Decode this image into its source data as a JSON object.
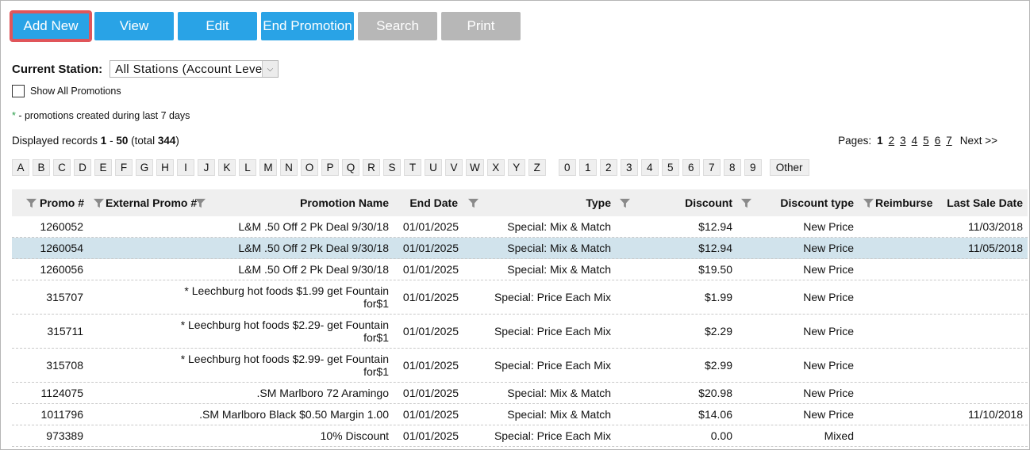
{
  "toolbar": {
    "add_new": "Add New",
    "view": "View",
    "edit": "Edit",
    "end_promotion": "End Promotion",
    "search": "Search",
    "print": "Print"
  },
  "station": {
    "label": "Current Station:",
    "selected": "All Stations (Account Level)"
  },
  "show_all_label": "Show All Promotions",
  "note": {
    "star": "*",
    "text": " - promotions created during last 7 days"
  },
  "records": {
    "prefix": "Displayed records ",
    "from": "1",
    "dash": " - ",
    "to": "50",
    "total_prefix": " (total ",
    "total": "344",
    "total_suffix": ")"
  },
  "pages": {
    "label": "Pages:",
    "current": "1",
    "list": [
      "2",
      "3",
      "4",
      "5",
      "6",
      "7"
    ],
    "next": "Next >>"
  },
  "alpha_letters": [
    "A",
    "B",
    "C",
    "D",
    "E",
    "F",
    "G",
    "H",
    "I",
    "J",
    "K",
    "L",
    "M",
    "N",
    "O",
    "P",
    "Q",
    "R",
    "S",
    "T",
    "U",
    "V",
    "W",
    "X",
    "Y",
    "Z"
  ],
  "alpha_digits": [
    "0",
    "1",
    "2",
    "3",
    "4",
    "5",
    "6",
    "7",
    "8",
    "9"
  ],
  "alpha_other": "Other",
  "columns": {
    "promo": "Promo #",
    "external": "External Promo #",
    "name": "Promotion Name",
    "end_date": "End Date",
    "type": "Type",
    "discount": "Discount",
    "discount_type": "Discount type",
    "reimburse": "Reimburse",
    "last_sale": "Last Sale Date"
  },
  "rows": [
    {
      "promo": "1260052",
      "name": "L&M .50 Off 2 Pk Deal 9/30/18",
      "end_date": "01/01/2025",
      "type": "Special: Mix & Match",
      "discount": "$12.94",
      "discount_type": "New Price",
      "last_sale": "11/03/2018"
    },
    {
      "promo": "1260054",
      "name": "L&M .50 Off 2 Pk Deal 9/30/18",
      "end_date": "01/01/2025",
      "type": "Special: Mix & Match",
      "discount": "$12.94",
      "discount_type": "New Price",
      "last_sale": "11/05/2018"
    },
    {
      "promo": "1260056",
      "name": "L&M .50 Off 2 Pk Deal 9/30/18",
      "end_date": "01/01/2025",
      "type": "Special: Mix & Match",
      "discount": "$19.50",
      "discount_type": "New Price",
      "last_sale": ""
    },
    {
      "promo": "315707",
      "name": "* Leechburg hot foods $1.99 get Fountain for$1",
      "end_date": "01/01/2025",
      "type": "Special: Price Each Mix",
      "discount": "$1.99",
      "discount_type": "New Price",
      "last_sale": ""
    },
    {
      "promo": "315711",
      "name": "* Leechburg hot foods $2.29- get Fountain for$1",
      "end_date": "01/01/2025",
      "type": "Special: Price Each Mix",
      "discount": "$2.29",
      "discount_type": "New Price",
      "last_sale": ""
    },
    {
      "promo": "315708",
      "name": "* Leechburg hot foods $2.99- get Fountain for$1",
      "end_date": "01/01/2025",
      "type": "Special: Price Each Mix",
      "discount": "$2.99",
      "discount_type": "New Price",
      "last_sale": ""
    },
    {
      "promo": "1124075",
      "name": ".SM Marlboro 72 Aramingo",
      "end_date": "01/01/2025",
      "type": "Special: Mix & Match",
      "discount": "$20.98",
      "discount_type": "New Price",
      "last_sale": ""
    },
    {
      "promo": "1011796",
      "name": ".SM Marlboro Black $0.50 Margin 1.00",
      "end_date": "01/01/2025",
      "type": "Special: Mix & Match",
      "discount": "$14.06",
      "discount_type": "New Price",
      "last_sale": "11/10/2018"
    },
    {
      "promo": "973389",
      "name": "10% Discount",
      "end_date": "01/01/2025",
      "type": "Special: Price Each Mix",
      "discount": "0.00",
      "discount_type": "Mixed",
      "last_sale": ""
    }
  ],
  "colors": {
    "button_blue": "#29a3e6",
    "button_gray": "#b7b7b7",
    "selected_outline": "#e0555a",
    "row_highlight": "#d1e3ec"
  }
}
